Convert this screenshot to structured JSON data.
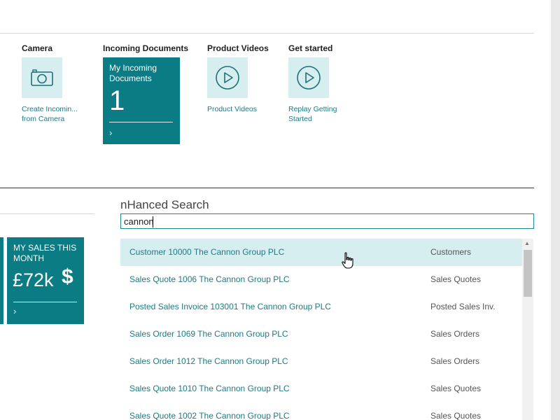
{
  "top_groups": {
    "camera": {
      "title": "Camera",
      "icon": "camera-icon",
      "label": "Create Incomin... from Camera"
    },
    "incoming_documents": {
      "title": "Incoming Documents",
      "cue_title": "My Incoming Documents",
      "cue_value": "1"
    },
    "product_videos": {
      "title": "Product Videos",
      "icon": "play-circle-icon",
      "label": "Product Videos"
    },
    "get_started": {
      "title": "Get started",
      "icon": "play-circle-icon",
      "label": "Replay Getting Started"
    }
  },
  "sales_cue": {
    "title": "MY SALES THIS MONTH",
    "value": "£72k",
    "symbol": "$"
  },
  "search": {
    "heading": "nHanced Search",
    "value": "cannon",
    "results": [
      {
        "name": "Customer 10000 The Cannon Group PLC",
        "type": "Customers"
      },
      {
        "name": "Sales Quote 1006 The Cannon Group PLC",
        "type": "Sales Quotes"
      },
      {
        "name": "Posted Sales Invoice 103001 The Cannon Group PLC",
        "type": "Posted Sales Inv."
      },
      {
        "name": "Sales Order 1069 The Cannon Group PLC",
        "type": "Sales Orders"
      },
      {
        "name": "Sales Order 1012 The Cannon Group PLC",
        "type": "Sales Orders"
      },
      {
        "name": "Sales Quote 1010 The Cannon Group PLC",
        "type": "Sales Quotes"
      },
      {
        "name": "Sales Quote 1002 The Cannon Group PLC",
        "type": "Sales Quotes"
      }
    ]
  },
  "colors": {
    "tile": "#0b7b84",
    "tile_light": "#d6eef0",
    "link": "#1f7a82",
    "selected_row": "#d6eef0"
  }
}
